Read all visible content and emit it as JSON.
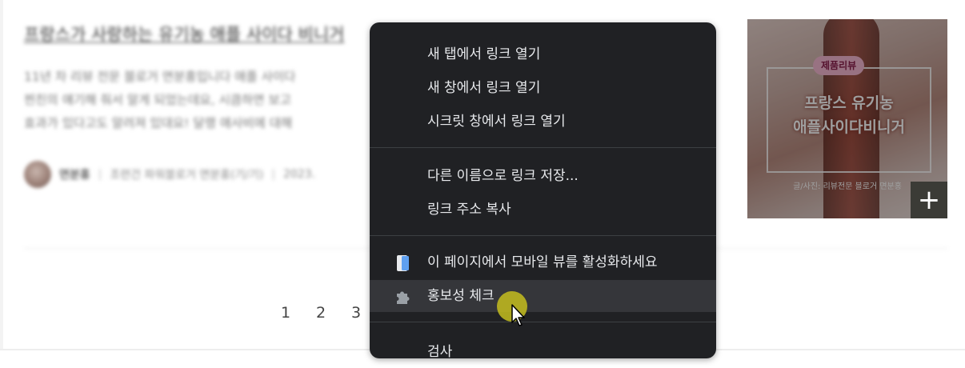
{
  "post": {
    "title": "프랑스가 사랑하는 유기농 애플 사이다 비니거",
    "excerpt_lines": [
      "11년 차 리뷰 전문 블로거 면분홍입니다 애플 사이다",
      "찐친의 얘기해 줘서 알게 되었는데요, 시큼하면 보고",
      "효과가 있다고도 알려져 있대요! 달랭 애사비에 대해"
    ],
    "author": "면분홍",
    "blog_name": "조련건 파워블로거 면분홍(기/기)",
    "date": "2023."
  },
  "thumbnail": {
    "badge": "제품리뷰",
    "headline_1": "프랑스 유기농",
    "headline_2": "애플사이다비니거",
    "credit": "글/사진: 리뷰전문 블로거 면분홍",
    "add_label": "+"
  },
  "pagination": [
    "1",
    "2",
    "3"
  ],
  "context_menu": {
    "items": [
      {
        "label": "새 탭에서 링크 열기"
      },
      {
        "label": "새 창에서 링크 열기"
      },
      {
        "label": "시크릿 창에서 링크 열기"
      },
      {
        "label": "다른 이름으로 링크 저장..."
      },
      {
        "label": "링크 주소 복사"
      },
      {
        "label": "이 페이지에서 모바일 뷰를 활성화하세요",
        "icon": "mobile-phone-icon"
      },
      {
        "label": "홍보성 체크",
        "icon": "puzzle-extension-icon"
      },
      {
        "label": "검사"
      }
    ],
    "hovered_index": 6
  },
  "colors": {
    "menu_bg": "#202124",
    "menu_hover": "#35363a",
    "menu_text": "#e8eaed",
    "click_highlight": "#c4bd1e"
  }
}
